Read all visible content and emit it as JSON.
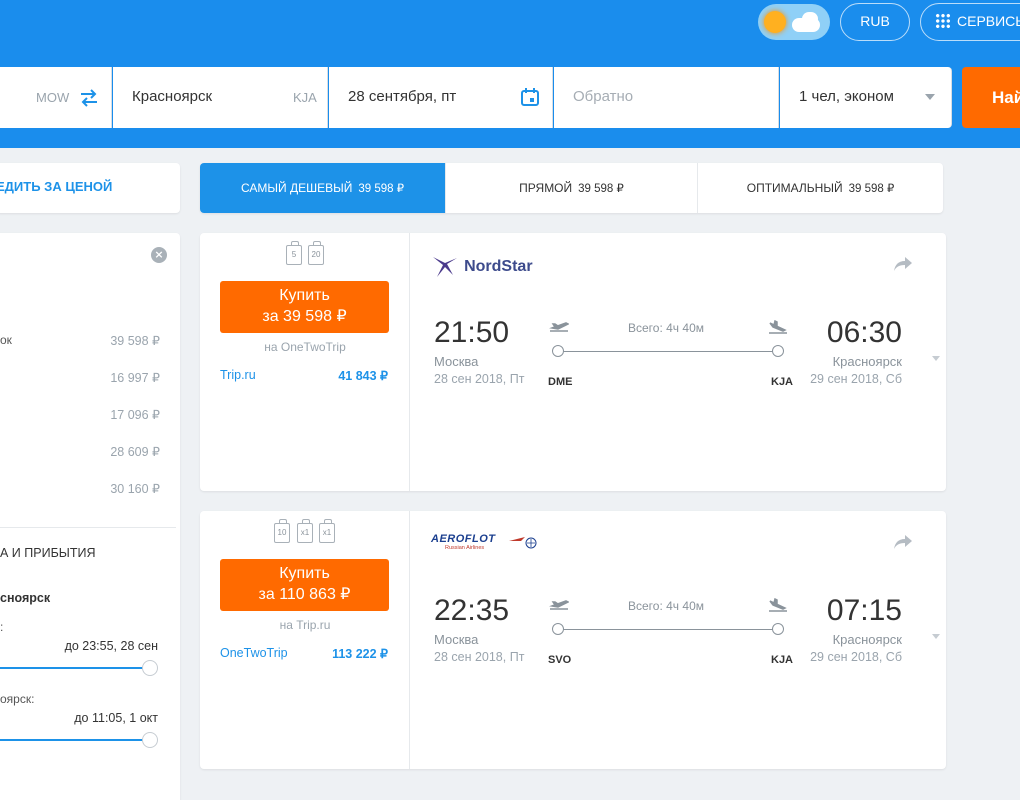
{
  "header": {
    "currency": "RUB",
    "services": "СЕРВИСЫ",
    "bg_color": "#1a8ded",
    "accent": "#ff6a00"
  },
  "search": {
    "origin_code": "MOW",
    "destination": "Красноярск",
    "destination_code": "KJA",
    "date": "28 сентября, пт",
    "return_placeholder": "Обратно",
    "passengers": "1 чел, эконом",
    "find_button": "Найти"
  },
  "sidebar": {
    "watch_price": "ЕДИТЬ ЗА ЦЕНОЙ",
    "filter_rows": [
      {
        "label": "ок",
        "value": "39 598 ₽"
      },
      {
        "label": "",
        "value": "16 997 ₽"
      },
      {
        "label": "",
        "value": "17 096 ₽"
      },
      {
        "label": "",
        "value": "28 609 ₽"
      },
      {
        "label": "",
        "value": "30 160 ₽"
      }
    ],
    "times_section": "А И ПРИБЫТИЯ",
    "city_bold": "сноярск",
    "departure_label": ":",
    "departure_value": "до 23:55, 28 сен",
    "arrival_label": "оярск:",
    "arrival_value": "до 11:05, 1 окт"
  },
  "tabs": [
    {
      "label": "САМЫЙ ДЕШЕВЫЙ",
      "price": "39 598 ₽"
    },
    {
      "label": "ПРЯМОЙ",
      "price": "39 598 ₽"
    },
    {
      "label": "ОПТИМАЛЬНЫЙ",
      "price": "39 598 ₽"
    }
  ],
  "tickets": [
    {
      "bags": [
        "5",
        "20"
      ],
      "buy_label": "Купить",
      "buy_price": "за 39 598 ₽",
      "via": "на OneTwoTrip",
      "alt_agent": "Trip.ru",
      "alt_price": "41 843 ₽",
      "airline": "NordStar",
      "dep_time": "21:50",
      "dep_city": "Москва",
      "dep_date": "28 сен 2018, Пт",
      "dep_iata": "DME",
      "total": "Всего: 4ч 40м",
      "arr_time": "06:30",
      "arr_city": "Красноярск",
      "arr_date": "29 сен 2018, Сб",
      "arr_iata": "KJA"
    },
    {
      "bags": [
        "10",
        "x1",
        "x1"
      ],
      "buy_label": "Купить",
      "buy_price": "за 110 863 ₽",
      "via": "на Trip.ru",
      "alt_agent": "OneTwoTrip",
      "alt_price": "113 222 ₽",
      "airline": "AEROFLOT",
      "airline_sub": "Russian Airlines",
      "dep_time": "22:35",
      "dep_city": "Москва",
      "dep_date": "28 сен 2018, Пт",
      "dep_iata": "SVO",
      "total": "Всего: 4ч 40м",
      "arr_time": "07:15",
      "arr_city": "Красноярск",
      "arr_date": "29 сен 2018, Сб",
      "arr_iata": "KJA"
    }
  ]
}
